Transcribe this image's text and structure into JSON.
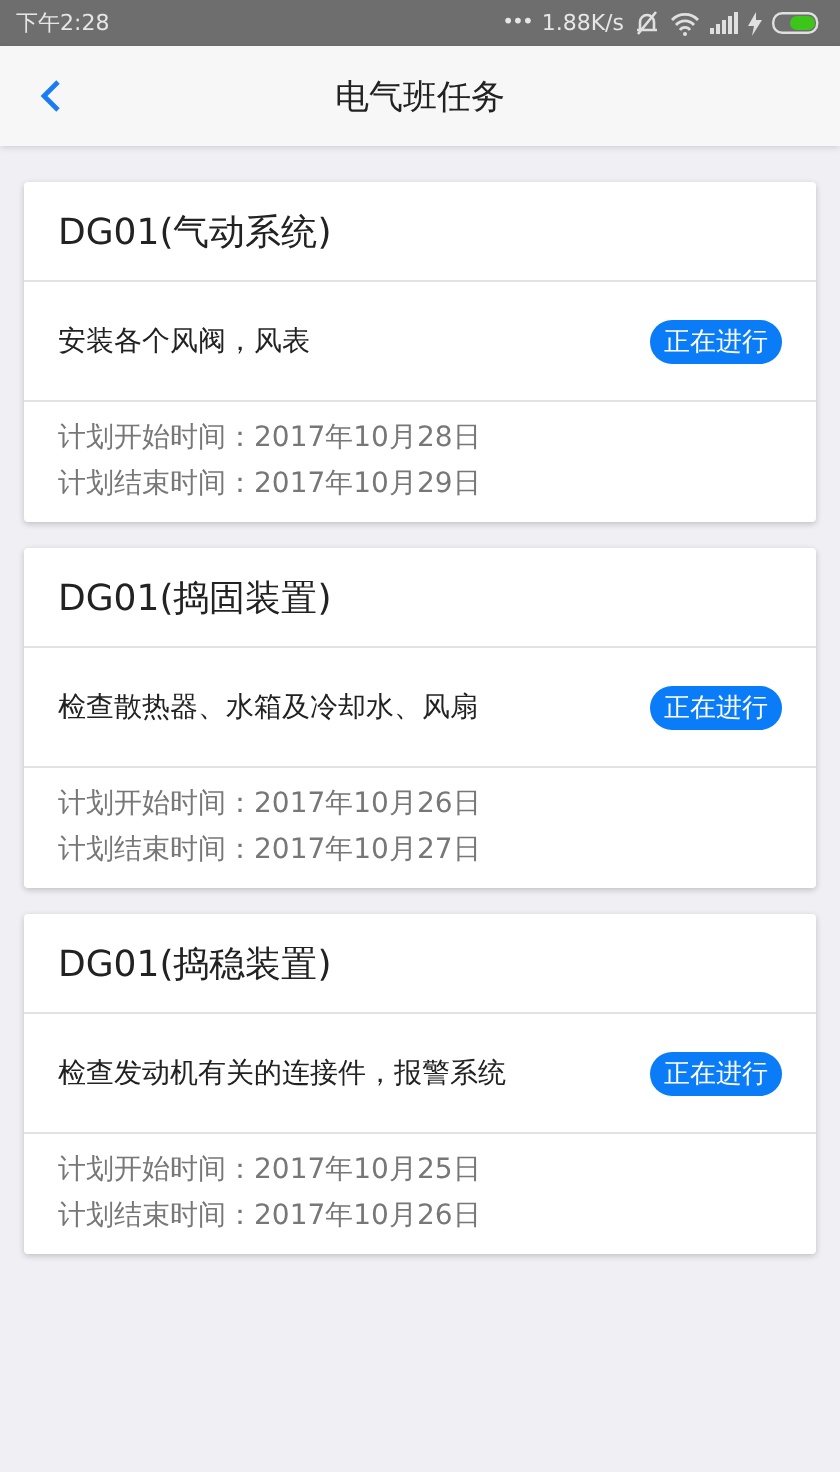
{
  "status_bar": {
    "time": "下午2:28",
    "dots": "•••",
    "speed": "1.88K/s"
  },
  "nav": {
    "title": "电气班任务"
  },
  "tasks": [
    {
      "title": "DG01(气动系统)",
      "description": "安装各个风阀，风表",
      "status": "正在进行",
      "start": "计划开始时间：2017年10月28日",
      "end": "计划结束时间：2017年10月29日"
    },
    {
      "title": "DG01(捣固装置)",
      "description": "检查散热器、水箱及冷却水、风扇",
      "status": "正在进行",
      "start": "计划开始时间：2017年10月26日",
      "end": "计划结束时间：2017年10月27日"
    },
    {
      "title": "DG01(捣稳装置)",
      "description": "检查发动机有关的连接件，报警系统",
      "status": "正在进行",
      "start": "计划开始时间：2017年10月25日",
      "end": "计划结束时间：2017年10月26日"
    }
  ]
}
